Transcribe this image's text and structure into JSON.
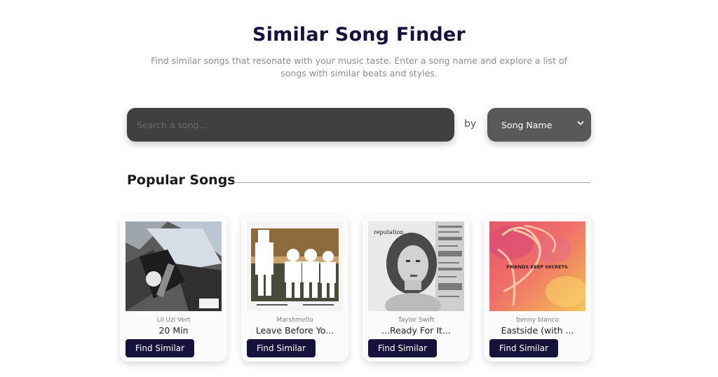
{
  "header": {
    "title": "Similar Song Finder",
    "subtitle": "Find similar songs that resonate with your music taste. Enter a song name and explore a list of songs with similar beats and styles."
  },
  "search": {
    "placeholder": "Search a song...",
    "by_label": "by",
    "select_value": "Song Name"
  },
  "popular": {
    "title": "Popular Songs",
    "button_label": "Find Similar",
    "songs": [
      {
        "artist": "Lil Uzi Vert",
        "title": "20 Min",
        "art_icon": "album-art-lil-uzi-vert"
      },
      {
        "artist": "Marshmello",
        "title": "Leave Before Yo...",
        "art_icon": "album-art-marshmello"
      },
      {
        "artist": "Taylor Swift",
        "title": "...Ready For It...",
        "art_icon": "album-art-reputation"
      },
      {
        "artist": "benny blanco",
        "title": "Eastside (with ...",
        "art_icon": "album-art-friends-keep-secrets"
      }
    ],
    "album_text": {
      "reputation": "reputation",
      "friends_keep_secrets": "FRIENDS KEEP SECRETS"
    }
  },
  "colors": {
    "title": "#15133c",
    "search_bg": "#404040",
    "select_bg": "#595959",
    "button_bg": "#15133c"
  }
}
